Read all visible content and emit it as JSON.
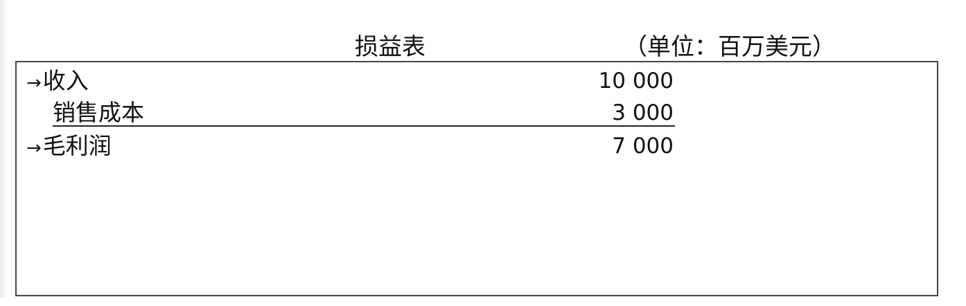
{
  "header": {
    "title": "损益表",
    "unit": "（单位：百万美元）"
  },
  "statement": {
    "rows": [
      {
        "arrow": "→",
        "label": "收入",
        "value": "10 000"
      },
      {
        "arrow": "",
        "label": "销售成本",
        "value": "3 000"
      },
      {
        "arrow": "→",
        "label": "毛利润",
        "value": "7 000"
      }
    ]
  }
}
